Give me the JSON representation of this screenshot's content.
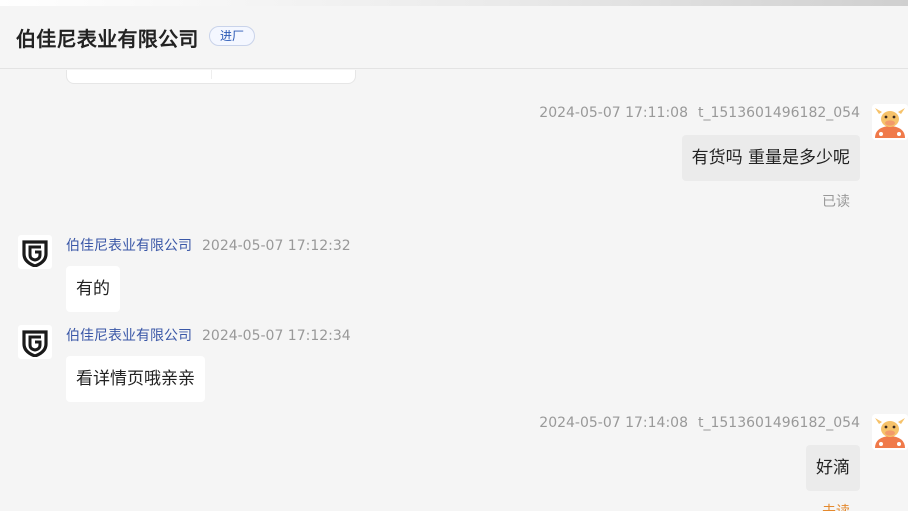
{
  "header": {
    "title": "伯佳尼表业有限公司",
    "tag": "进厂"
  },
  "messages": [
    {
      "direction": "out",
      "timestamp": "2024-05-07 17:11:08",
      "user_id": "t_1513601496182_054",
      "text": "有货吗 重量是多少呢",
      "status": "已读"
    },
    {
      "direction": "in",
      "sender": "伯佳尼表业有限公司",
      "timestamp": "2024-05-07 17:12:32",
      "text": "有的"
    },
    {
      "direction": "in",
      "sender": "伯佳尼表业有限公司",
      "timestamp": "2024-05-07 17:12:34",
      "text": "看详情页哦亲亲"
    },
    {
      "direction": "out",
      "timestamp": "2024-05-07 17:14:08",
      "user_id": "t_1513601496182_054",
      "text": "好滴",
      "status": "未读"
    }
  ],
  "colors": {
    "sender_name": "#3a57a7",
    "unread": "#e4892d",
    "tag_text": "#2a59b5"
  },
  "icons": {
    "shop_avatar": "shield-g-logo-icon",
    "user_avatar": "cartoon-cow-avatar-icon"
  }
}
